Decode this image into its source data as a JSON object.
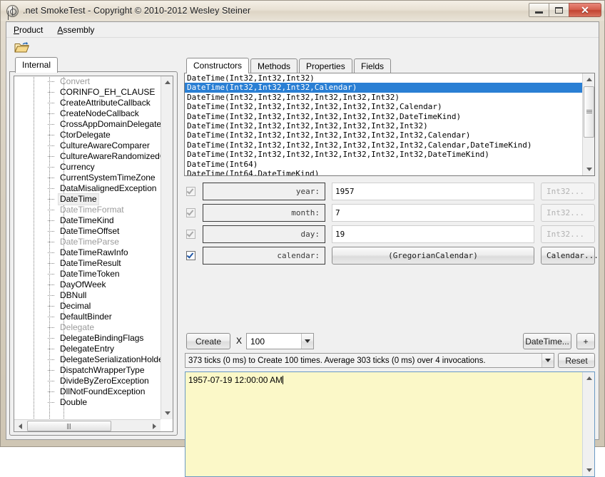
{
  "window": {
    "title": ".net SmokeTest - Copyright © 2010-2012 Wesley Steiner",
    "icon": "target-app-icon",
    "controls": {
      "minimize": "–",
      "maximize": "□",
      "close": "✕"
    }
  },
  "menubar": {
    "items": [
      {
        "label": "Product",
        "mnemonic": "P"
      },
      {
        "label": "Assembly",
        "mnemonic": "A"
      }
    ]
  },
  "left_panel": {
    "toolbar": {
      "open_icon": "open-folder-icon"
    },
    "tab": {
      "label": "Internal",
      "selected": true
    },
    "tree": {
      "nodes": [
        {
          "label": "Convert",
          "dim": true,
          "selected": false
        },
        {
          "label": "CORINFO_EH_CLAUSE",
          "dim": false,
          "selected": false
        },
        {
          "label": "CreateAttributeCallback",
          "dim": false,
          "selected": false
        },
        {
          "label": "CreateNodeCallback",
          "dim": false,
          "selected": false
        },
        {
          "label": "CrossAppDomainDelegate",
          "dim": false,
          "selected": false
        },
        {
          "label": "CtorDelegate",
          "dim": false,
          "selected": false
        },
        {
          "label": "CultureAwareComparer",
          "dim": false,
          "selected": false
        },
        {
          "label": "CultureAwareRandomizedCor",
          "dim": false,
          "selected": false
        },
        {
          "label": "Currency",
          "dim": false,
          "selected": false
        },
        {
          "label": "CurrentSystemTimeZone",
          "dim": false,
          "selected": false
        },
        {
          "label": "DataMisalignedException",
          "dim": false,
          "selected": false
        },
        {
          "label": "DateTime",
          "dim": false,
          "selected": true
        },
        {
          "label": "DateTimeFormat",
          "dim": true,
          "selected": false
        },
        {
          "label": "DateTimeKind",
          "dim": false,
          "selected": false
        },
        {
          "label": "DateTimeOffset",
          "dim": false,
          "selected": false
        },
        {
          "label": "DateTimeParse",
          "dim": true,
          "selected": false
        },
        {
          "label": "DateTimeRawInfo",
          "dim": false,
          "selected": false
        },
        {
          "label": "DateTimeResult",
          "dim": false,
          "selected": false
        },
        {
          "label": "DateTimeToken",
          "dim": false,
          "selected": false
        },
        {
          "label": "DayOfWeek",
          "dim": false,
          "selected": false
        },
        {
          "label": "DBNull",
          "dim": false,
          "selected": false
        },
        {
          "label": "Decimal",
          "dim": false,
          "selected": false
        },
        {
          "label": "DefaultBinder",
          "dim": false,
          "selected": false
        },
        {
          "label": "Delegate",
          "dim": true,
          "selected": false
        },
        {
          "label": "DelegateBindingFlags",
          "dim": false,
          "selected": false
        },
        {
          "label": "DelegateEntry",
          "dim": false,
          "selected": false
        },
        {
          "label": "DelegateSerializationHolder",
          "dim": false,
          "selected": false
        },
        {
          "label": "DispatchWrapperType",
          "dim": false,
          "selected": false
        },
        {
          "label": "DivideByZeroException",
          "dim": false,
          "selected": false
        },
        {
          "label": "DllNotFoundException",
          "dim": false,
          "selected": false
        },
        {
          "label": "Double",
          "dim": false,
          "selected": false
        }
      ]
    }
  },
  "right_panel": {
    "tabs": [
      {
        "label": "Constructors",
        "active": true
      },
      {
        "label": "Methods",
        "active": false
      },
      {
        "label": "Properties",
        "active": false
      },
      {
        "label": "Fields",
        "active": false
      }
    ],
    "constructors": [
      {
        "signature": "DateTime(Int32,Int32,Int32)",
        "selected": false
      },
      {
        "signature": "DateTime(Int32,Int32,Int32,Calendar)",
        "selected": true
      },
      {
        "signature": "DateTime(Int32,Int32,Int32,Int32,Int32,Int32)",
        "selected": false
      },
      {
        "signature": "DateTime(Int32,Int32,Int32,Int32,Int32,Int32,Calendar)",
        "selected": false
      },
      {
        "signature": "DateTime(Int32,Int32,Int32,Int32,Int32,Int32,DateTimeKind)",
        "selected": false
      },
      {
        "signature": "DateTime(Int32,Int32,Int32,Int32,Int32,Int32,Int32)",
        "selected": false
      },
      {
        "signature": "DateTime(Int32,Int32,Int32,Int32,Int32,Int32,Int32,Calendar)",
        "selected": false
      },
      {
        "signature": "DateTime(Int32,Int32,Int32,Int32,Int32,Int32,Int32,Calendar,DateTimeKind)",
        "selected": false
      },
      {
        "signature": "DateTime(Int32,Int32,Int32,Int32,Int32,Int32,Int32,DateTimeKind)",
        "selected": false
      },
      {
        "signature": "DateTime(Int64)",
        "selected": false
      },
      {
        "signature": "DateTime(Int64,DateTimeKind)",
        "selected": false
      }
    ],
    "parameters": [
      {
        "checked": true,
        "enabled": false,
        "label": "year:",
        "value": "1957",
        "value_is_button": false,
        "type_label": "Int32...",
        "type_enabled": false
      },
      {
        "checked": true,
        "enabled": false,
        "label": "month:",
        "value": "7",
        "value_is_button": false,
        "type_label": "Int32...",
        "type_enabled": false
      },
      {
        "checked": true,
        "enabled": false,
        "label": "day:",
        "value": "19",
        "value_is_button": false,
        "type_label": "Int32...",
        "type_enabled": false
      },
      {
        "checked": true,
        "enabled": true,
        "label": "calendar:",
        "value": "(GregorianCalendar)",
        "value_is_button": true,
        "type_label": "Calendar...",
        "type_enabled": true
      }
    ],
    "actions": {
      "create_label": "Create",
      "times_label": "X",
      "count_value": "100",
      "datetime_label": "DateTime...",
      "plus_label": "+",
      "status_text": "373 ticks (0 ms) to Create 100 times. Average 303 ticks (0 ms) over 4 invocations.",
      "reset_label": "Reset"
    },
    "output": {
      "text": "1957-07-19 12:00:00 AM"
    }
  },
  "colors": {
    "selection_blue": "#2a7fd4",
    "output_background": "#fbf8c8",
    "frame_beige": "#d8d0c0",
    "close_red": "#c24432"
  }
}
